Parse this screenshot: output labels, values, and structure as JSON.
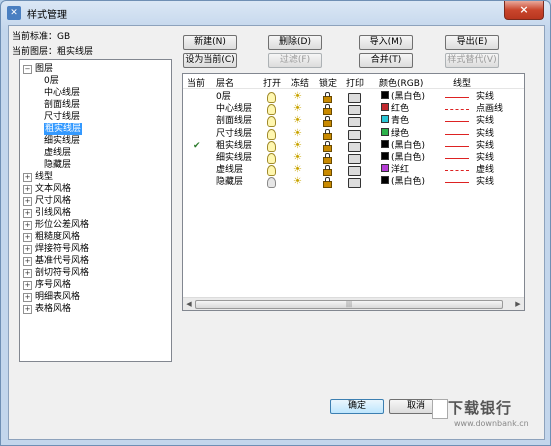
{
  "window": {
    "title": "样式管理",
    "close_label": "×"
  },
  "info": {
    "standard_label": "当前标准：GB",
    "layer_label": "当前图层：粗实线层"
  },
  "tree": [
    {
      "label": "图层",
      "toggle": "−",
      "level": 0
    },
    {
      "label": "0层",
      "level": 1
    },
    {
      "label": "中心线层",
      "level": 1
    },
    {
      "label": "剖面线层",
      "level": 1
    },
    {
      "label": "尺寸线层",
      "level": 1
    },
    {
      "label": "粗实线层",
      "level": 1,
      "selected": true
    },
    {
      "label": "细实线层",
      "level": 1
    },
    {
      "label": "虚线层",
      "level": 1
    },
    {
      "label": "隐藏层",
      "level": 1
    },
    {
      "label": "线型",
      "toggle": "+",
      "level": 0
    },
    {
      "label": "文本风格",
      "toggle": "+",
      "level": 0
    },
    {
      "label": "尺寸风格",
      "toggle": "+",
      "level": 0
    },
    {
      "label": "引线风格",
      "toggle": "+",
      "level": 0
    },
    {
      "label": "形位公差风格",
      "toggle": "+",
      "level": 0
    },
    {
      "label": "粗糙度风格",
      "toggle": "+",
      "level": 0
    },
    {
      "label": "焊接符号风格",
      "toggle": "+",
      "level": 0
    },
    {
      "label": "基准代号风格",
      "toggle": "+",
      "level": 0
    },
    {
      "label": "剖切符号风格",
      "toggle": "+",
      "level": 0
    },
    {
      "label": "序号风格",
      "toggle": "+",
      "level": 0
    },
    {
      "label": "明细表风格",
      "toggle": "+",
      "level": 0
    },
    {
      "label": "表格风格",
      "toggle": "+",
      "level": 0
    }
  ],
  "buttons": {
    "new": "新建(N)",
    "delete": "删除(D)",
    "import": "导入(M)",
    "export": "导出(E)",
    "set_current": "设为当前(C)",
    "filter": "过滤(F)",
    "merge": "合并(T)",
    "style_replace": "样式替代(V)",
    "ok": "确定",
    "cancel": "取消"
  },
  "columns": [
    "当前",
    "层名",
    "打开",
    "冻结",
    "锁定",
    "打印",
    "颜色(RGB)",
    "线型"
  ],
  "layers": [
    {
      "current": "",
      "name": "0层",
      "open": true,
      "color_name": "(黑白色)",
      "color": "#000000",
      "linetype": "实线",
      "lt": "solid"
    },
    {
      "current": "",
      "name": "中心线层",
      "open": true,
      "color_name": "红色",
      "color": "#c0282d",
      "linetype": "点画线",
      "lt": "dashdot"
    },
    {
      "current": "",
      "name": "剖面线层",
      "open": true,
      "color_name": "青色",
      "color": "#29c5d4",
      "linetype": "实线",
      "lt": "solid"
    },
    {
      "current": "",
      "name": "尺寸线层",
      "open": true,
      "color_name": "绿色",
      "color": "#2cb24a",
      "linetype": "实线",
      "lt": "solid"
    },
    {
      "current": "✔",
      "name": "粗实线层",
      "open": true,
      "color_name": "(黑白色)",
      "color": "#000000",
      "linetype": "实线",
      "lt": "solid"
    },
    {
      "current": "",
      "name": "细实线层",
      "open": true,
      "color_name": "(黑白色)",
      "color": "#000000",
      "linetype": "实线",
      "lt": "solid"
    },
    {
      "current": "",
      "name": "虚线层",
      "open": true,
      "color_name": "洋红",
      "color": "#b43cd4",
      "linetype": "虚线",
      "lt": "dash"
    },
    {
      "current": "",
      "name": "隐藏层",
      "open": false,
      "color_name": "(黑白色)",
      "color": "#000000",
      "linetype": "实线",
      "lt": "solid"
    }
  ],
  "scroll": {
    "thumb_grip": "|||",
    "left": "◀",
    "right": "▶"
  },
  "watermark": {
    "brand": "下载银行",
    "url": "www.downbank.cn"
  }
}
